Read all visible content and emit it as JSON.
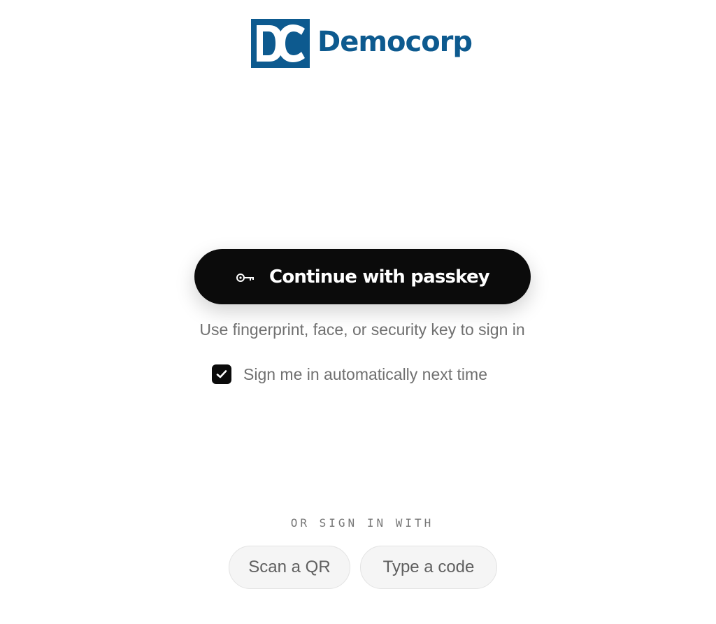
{
  "brand": {
    "logo_mark": "DC",
    "name": "Democorp",
    "color": "#0d5a8f"
  },
  "passkey": {
    "button_label": "Continue with passkey",
    "icon": "key-icon",
    "helper": "Use fingerprint, face, or security key to sign in"
  },
  "remember": {
    "label": "Sign me in automatically next time",
    "checked": true
  },
  "alternatives": {
    "heading": "OR SIGN IN WITH",
    "options": [
      {
        "label": "Scan a QR"
      },
      {
        "label": "Type a code"
      }
    ]
  }
}
